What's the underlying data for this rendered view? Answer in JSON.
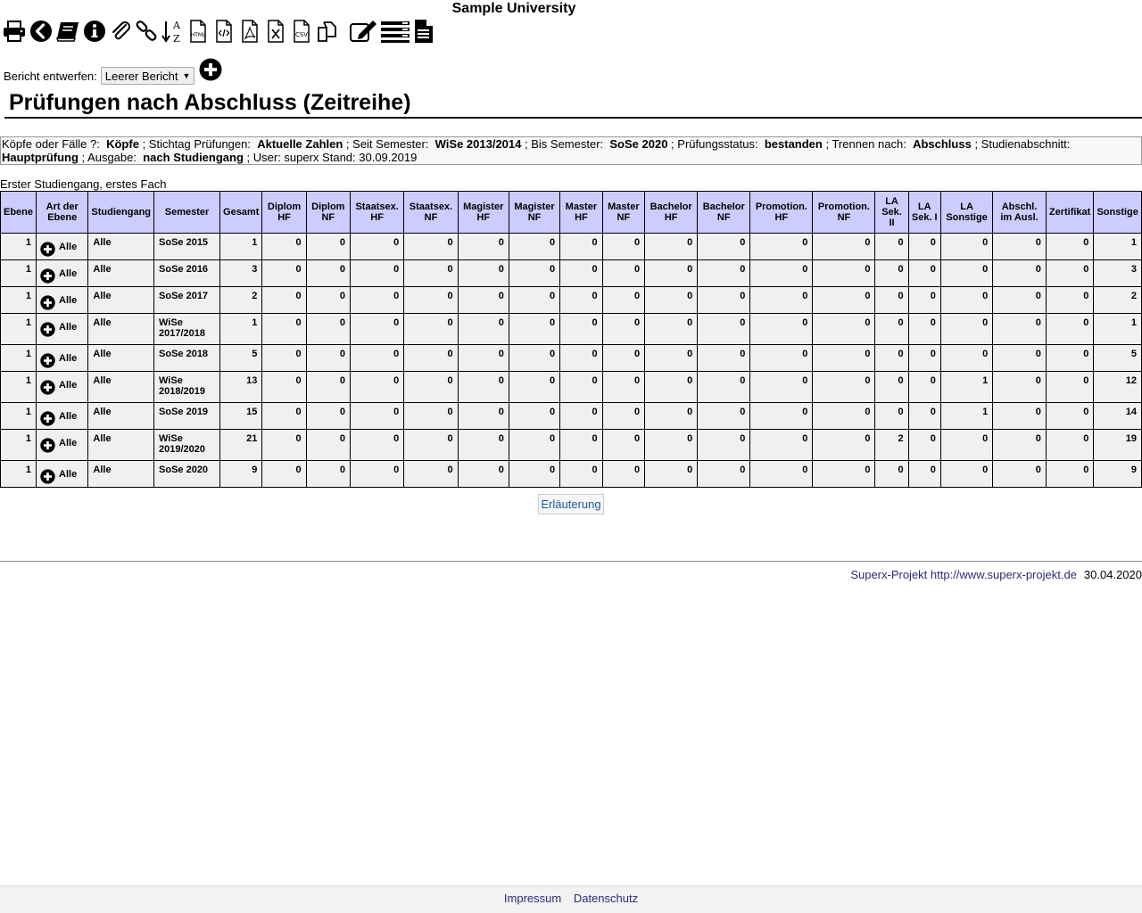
{
  "header": {
    "university": "Sample University"
  },
  "toolbar": {
    "icons": [
      "print-icon",
      "back-icon",
      "book-icon",
      "info-icon",
      "paperclip-icon",
      "link-icon",
      "sort-az-icon",
      "html-export-icon",
      "code-export-icon",
      "pdf-export-icon",
      "excel-export-icon",
      "csv-export-icon",
      "copy-icon",
      "edit-icon",
      "list-icon",
      "document-icon"
    ],
    "sort_letters": {
      "top": "A",
      "bottom": "Z"
    },
    "html_label": "HTML",
    "csv_label": "CSV"
  },
  "report": {
    "label": "Bericht entwerfen:",
    "selected": "Leerer Bericht"
  },
  "title": "Prüfungen nach Abschluss (Zeitreihe)",
  "params": [
    {
      "label": "Köpfe oder Fälle ?:",
      "value": "Köpfe"
    },
    {
      "label": "; Stichtag Prüfungen:",
      "value": "Aktuelle Zahlen"
    },
    {
      "label": "; Seit Semester:",
      "value": "WiSe 2013/2014"
    },
    {
      "label": "; Bis Semester:",
      "value": "SoSe 2020"
    },
    {
      "label": "; Prüfungsstatus:",
      "value": "bestanden"
    },
    {
      "label": "; Trennen nach:",
      "value": "Abschluss"
    },
    {
      "label": "; Studienabschnitt:",
      "value": "Hauptprüfung"
    },
    {
      "label": "; Ausgabe:",
      "value": "nach Studiengang"
    }
  ],
  "params_tail": "; User: superx  Stand: 30.09.2019",
  "sub_caption": "Erster Studiengang, erstes Fach",
  "table": {
    "headers": [
      "Ebene",
      "Art der Ebene",
      "Studiengang",
      "Semester",
      "Gesamt",
      "Diplom HF",
      "Diplom NF",
      "Staatsex. HF",
      "Staatsex. NF",
      "Magister HF",
      "Magister NF",
      "Master HF",
      "Master NF",
      "Bachelor HF",
      "Bachelor NF",
      "Promotion. HF",
      "Promotion. NF",
      "LA Sek. II",
      "LA Sek. I",
      "LA Sonstige",
      "Abschl. im Ausl.",
      "Zertifikat",
      "Sonstige"
    ],
    "rows": [
      {
        "ebene": "1",
        "art": "Alle",
        "studiengang": "Alle",
        "semester": "SoSe 2015",
        "values": [
          "1",
          "0",
          "0",
          "0",
          "0",
          "0",
          "0",
          "0",
          "0",
          "0",
          "0",
          "0",
          "0",
          "0",
          "0",
          "0",
          "0",
          "0",
          "1"
        ]
      },
      {
        "ebene": "1",
        "art": "Alle",
        "studiengang": "Alle",
        "semester": "SoSe 2016",
        "values": [
          "3",
          "0",
          "0",
          "0",
          "0",
          "0",
          "0",
          "0",
          "0",
          "0",
          "0",
          "0",
          "0",
          "0",
          "0",
          "0",
          "0",
          "0",
          "3"
        ]
      },
      {
        "ebene": "1",
        "art": "Alle",
        "studiengang": "Alle",
        "semester": "SoSe 2017",
        "values": [
          "2",
          "0",
          "0",
          "0",
          "0",
          "0",
          "0",
          "0",
          "0",
          "0",
          "0",
          "0",
          "0",
          "0",
          "0",
          "0",
          "0",
          "0",
          "2"
        ]
      },
      {
        "ebene": "1",
        "art": "Alle",
        "studiengang": "Alle",
        "semester": "WiSe 2017/2018",
        "values": [
          "1",
          "0",
          "0",
          "0",
          "0",
          "0",
          "0",
          "0",
          "0",
          "0",
          "0",
          "0",
          "0",
          "0",
          "0",
          "0",
          "0",
          "0",
          "1"
        ]
      },
      {
        "ebene": "1",
        "art": "Alle",
        "studiengang": "Alle",
        "semester": "SoSe 2018",
        "values": [
          "5",
          "0",
          "0",
          "0",
          "0",
          "0",
          "0",
          "0",
          "0",
          "0",
          "0",
          "0",
          "0",
          "0",
          "0",
          "0",
          "0",
          "0",
          "5"
        ]
      },
      {
        "ebene": "1",
        "art": "Alle",
        "studiengang": "Alle",
        "semester": "WiSe 2018/2019",
        "values": [
          "13",
          "0",
          "0",
          "0",
          "0",
          "0",
          "0",
          "0",
          "0",
          "0",
          "0",
          "0",
          "0",
          "0",
          "0",
          "1",
          "0",
          "0",
          "12"
        ]
      },
      {
        "ebene": "1",
        "art": "Alle",
        "studiengang": "Alle",
        "semester": "SoSe 2019",
        "values": [
          "15",
          "0",
          "0",
          "0",
          "0",
          "0",
          "0",
          "0",
          "0",
          "0",
          "0",
          "0",
          "0",
          "0",
          "0",
          "1",
          "0",
          "0",
          "14"
        ]
      },
      {
        "ebene": "1",
        "art": "Alle",
        "studiengang": "Alle",
        "semester": "WiSe 2019/2020",
        "values": [
          "21",
          "0",
          "0",
          "0",
          "0",
          "0",
          "0",
          "0",
          "0",
          "0",
          "0",
          "0",
          "0",
          "2",
          "0",
          "0",
          "0",
          "0",
          "19"
        ]
      },
      {
        "ebene": "1",
        "art": "Alle",
        "studiengang": "Alle",
        "semester": "SoSe 2020",
        "values": [
          "9",
          "0",
          "0",
          "0",
          "0",
          "0",
          "0",
          "0",
          "0",
          "0",
          "0",
          "0",
          "0",
          "0",
          "0",
          "0",
          "0",
          "0",
          "9"
        ]
      }
    ]
  },
  "explanation_button": "Erläuterung",
  "footer": {
    "link_text": "Superx-Projekt http://www.superx-projekt.de",
    "date": "30.04.2020"
  },
  "bottom_links": [
    "Impressum",
    "Datenschutz"
  ],
  "colors": {
    "header_bg": "#ccccff",
    "cell_bg": "#f0f0f0",
    "link": "#2b2b7a"
  }
}
